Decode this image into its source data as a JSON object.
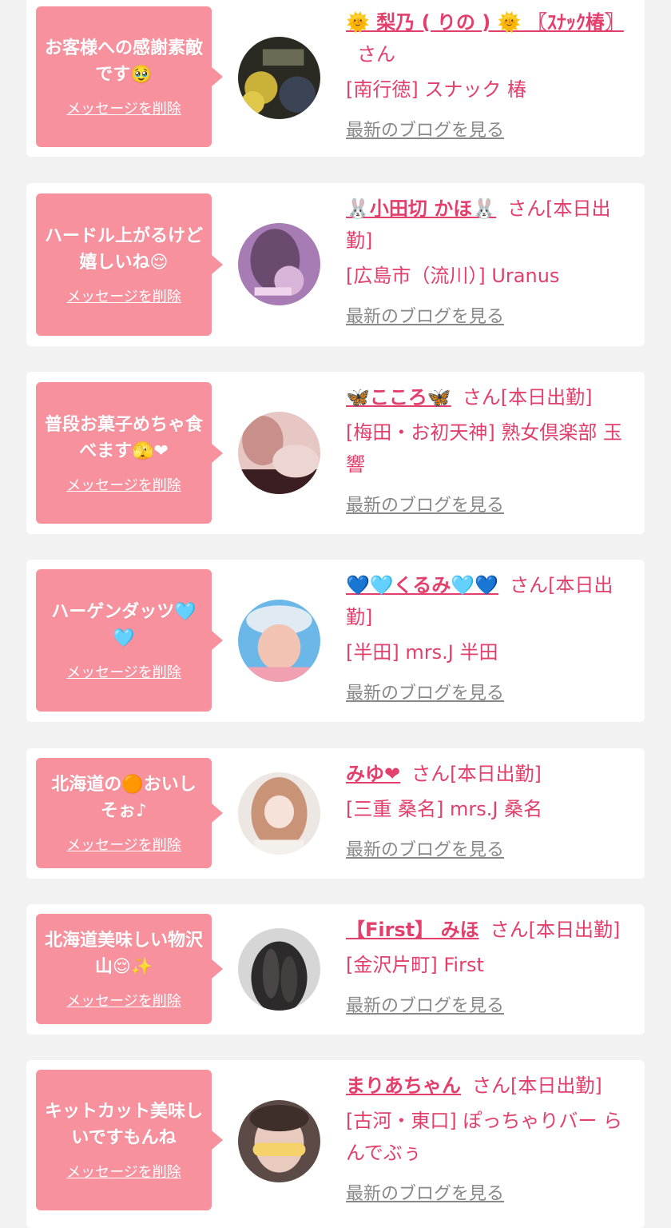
{
  "delete_label": "メッセージを削除",
  "blog_label": "最新のブログを見る",
  "san": "さん",
  "colors": {
    "accent": "#e23f6c",
    "bubble": "#f6919d",
    "muted": "#888888"
  },
  "entries": [
    {
      "message": "お客様への感謝素敵です🥹",
      "name": "🌞 梨乃 ( りの ) 🌞 〖ｽﾅｯｸ椿〗",
      "suffix": "",
      "shop": "[南行徳] スナック 椿"
    },
    {
      "message": "ハードル上がるけど嬉しいね😌",
      "name": "🐰小田切 かほ🐰",
      "suffix": "[本日出勤]",
      "shop": "[広島市（流川）] Uranus"
    },
    {
      "message": "普段お菓子めちゃ食べます🫣❤",
      "name": "🦋こころ🦋",
      "suffix": "[本日出勤]",
      "shop": "[梅田・お初天神] 熟女倶楽部 玉響"
    },
    {
      "message": "ハーゲンダッツ🩵🩵",
      "name": "💙🩵くるみ🩵💙",
      "suffix": "[本日出勤]",
      "shop": "[半田] mrs.J 半田"
    },
    {
      "message": "北海道の🟠おいしそぉ♪",
      "name": "みゆ❤",
      "suffix": "[本日出勤]",
      "shop": "[三重 桑名] mrs.J 桑名"
    },
    {
      "message": "北海道美味しい物沢山😌✨",
      "name": "【First】 みほ",
      "suffix": "[本日出勤]",
      "shop": "[金沢片町] First"
    },
    {
      "message": "キットカット美味しいですもんね",
      "name": "まりあちゃん",
      "suffix": "[本日出勤]",
      "shop": "[古河・東口] ぽっちゃりバー らんでぶぅ"
    }
  ]
}
